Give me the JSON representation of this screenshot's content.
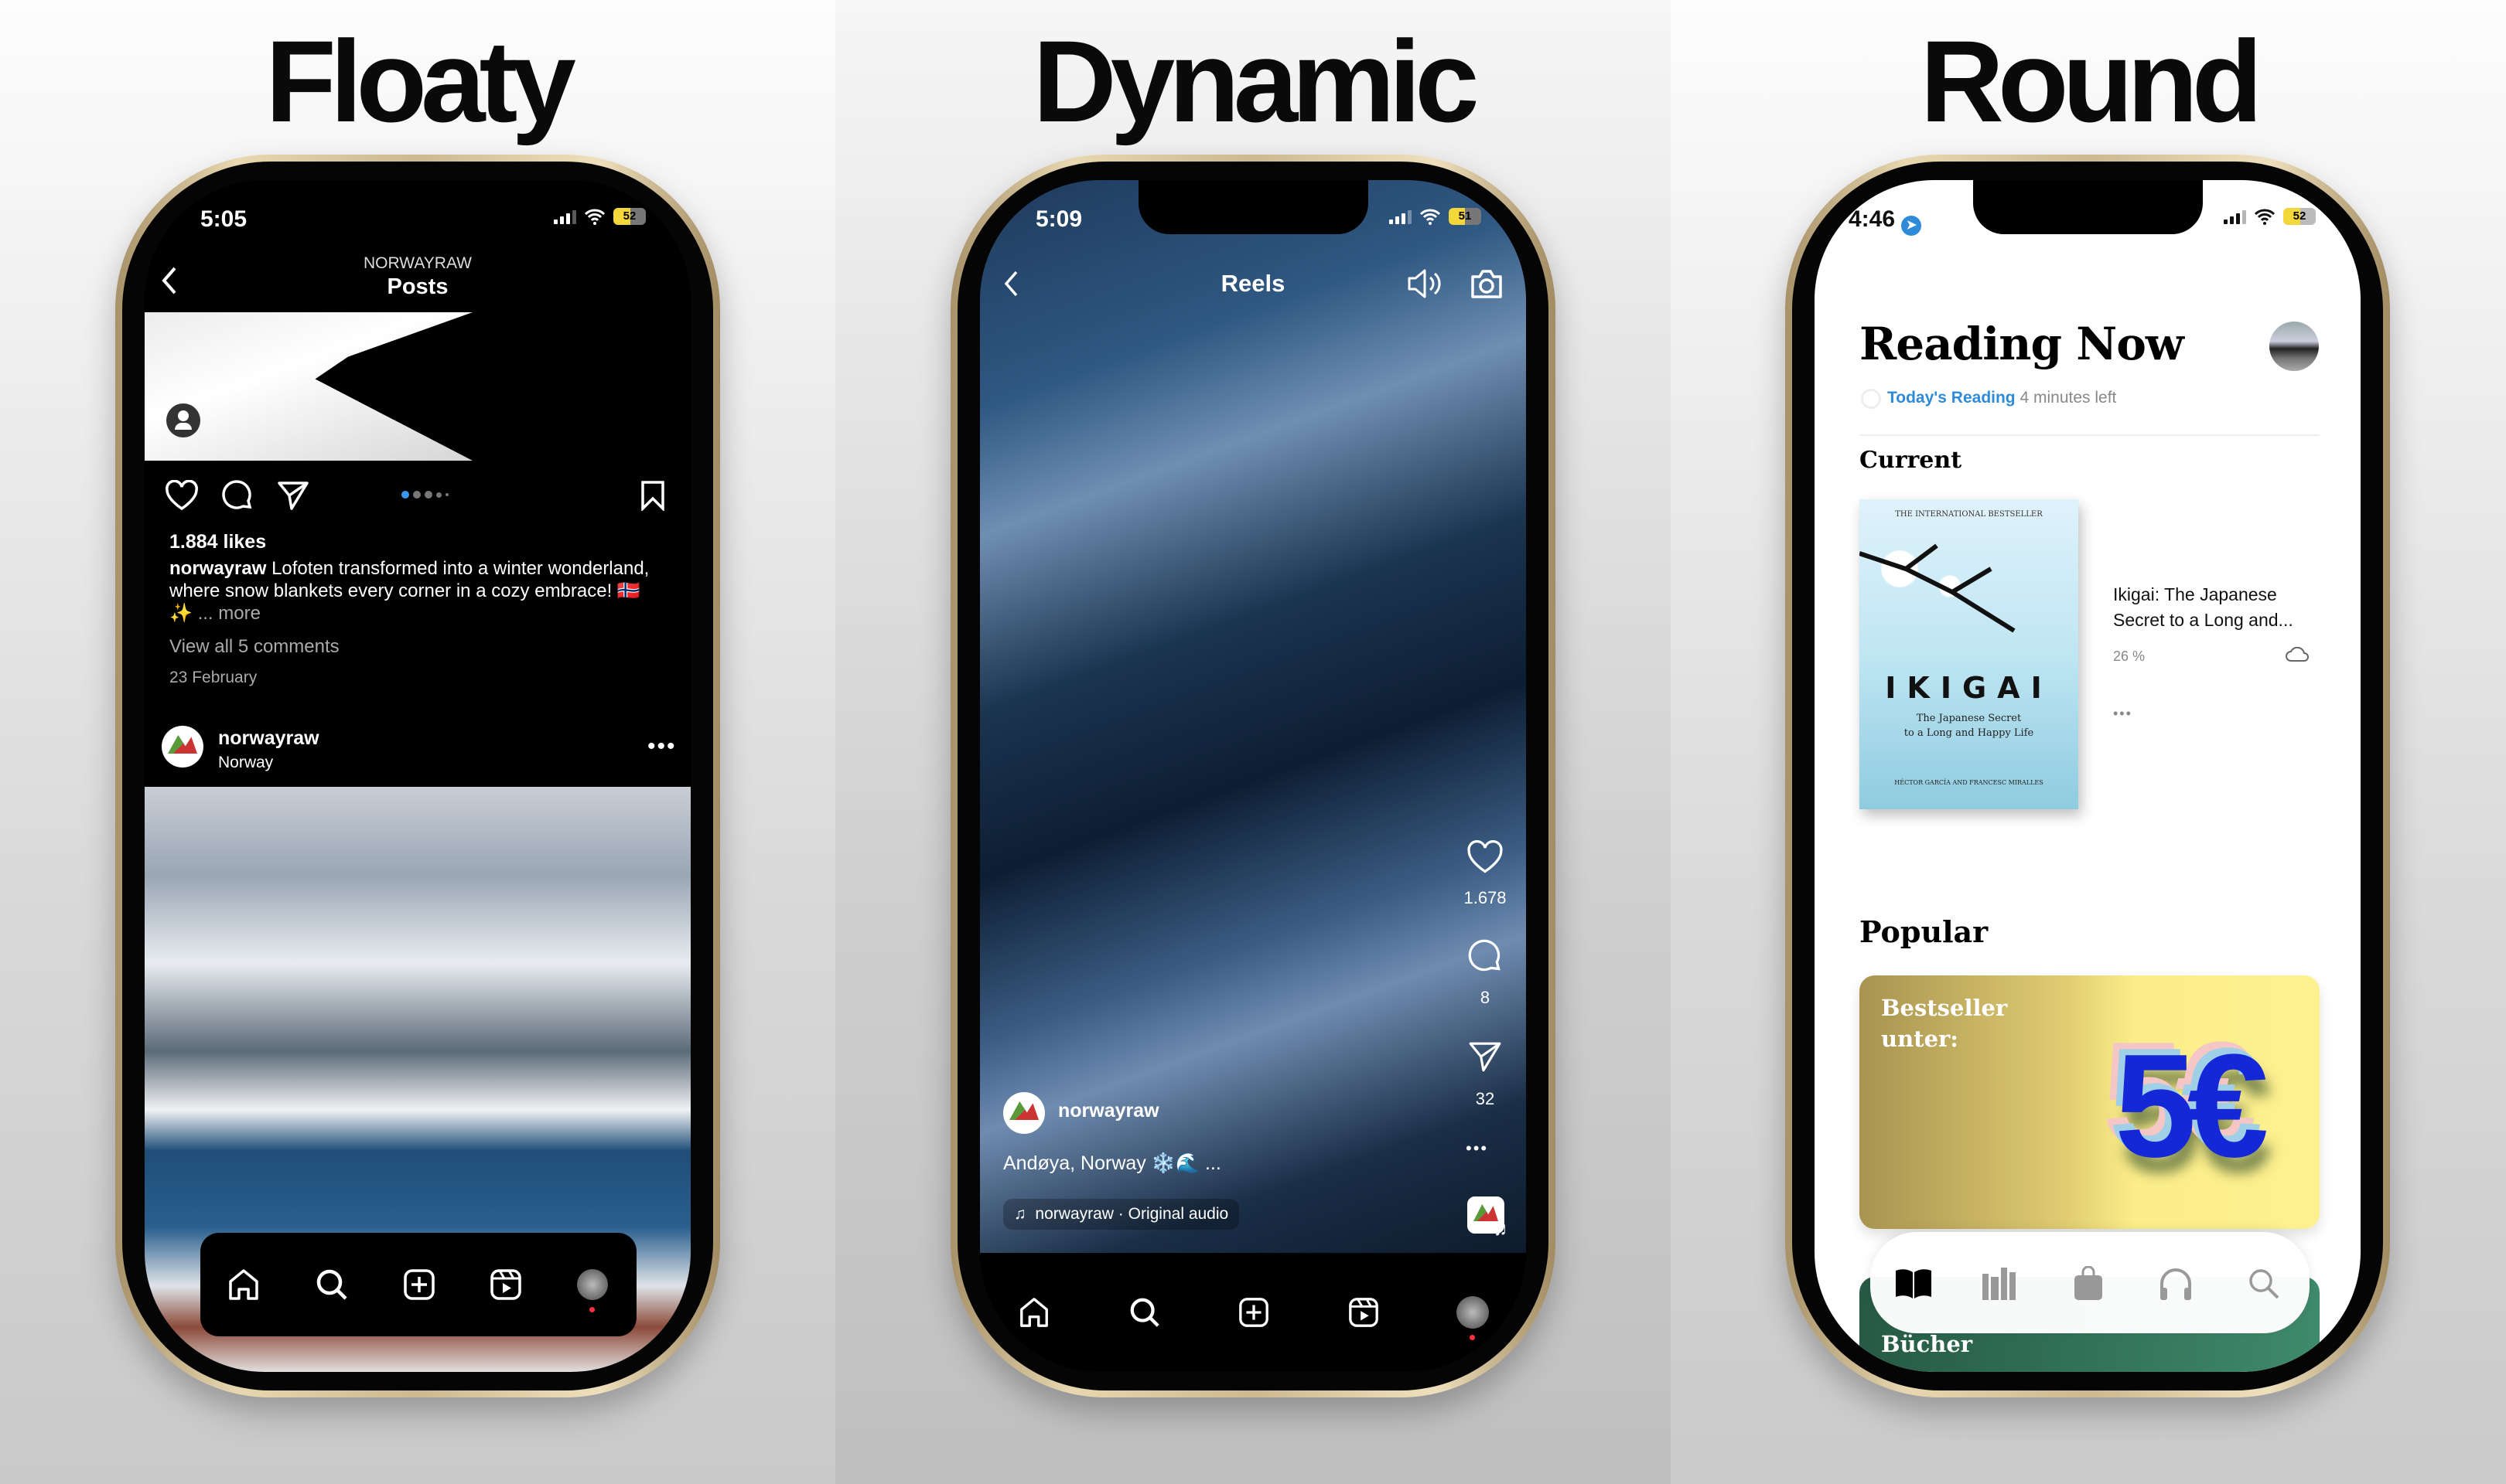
{
  "headings": [
    "Floaty",
    "Dynamic",
    "Round"
  ],
  "floaty": {
    "status": {
      "time": "5:05",
      "battery": "52"
    },
    "header": {
      "account": "NORWAYRAW",
      "title": "Posts"
    },
    "post": {
      "likes": "1.884 likes",
      "username": "norwayraw",
      "caption": "Lofoten transformed into a winter wonderland, where snow blankets every corner in a cozy embrace! 🇳🇴 ✨",
      "more": "... more",
      "comments": "View all 5 comments",
      "date": "23 February",
      "carousel_index": 1,
      "carousel_count": 5
    },
    "next_post": {
      "username": "norwayraw",
      "location": "Norway"
    },
    "tabbar": {
      "icons": [
        "home-icon",
        "search-icon",
        "create-icon",
        "reels-icon",
        "profile-avatar"
      ]
    }
  },
  "dynamic": {
    "status": {
      "time": "5:09",
      "battery": "51"
    },
    "header": {
      "title": "Reels"
    },
    "actions": {
      "likes": "1.678",
      "comments": "8",
      "shares": "32"
    },
    "reel": {
      "username": "norwayraw",
      "caption": "Andøya, Norway ❄️🌊 ...",
      "audio": "norwayraw · Original audio"
    }
  },
  "round": {
    "status": {
      "time": "4:46",
      "battery": "52"
    },
    "title": "Reading Now",
    "goal": {
      "label": "Today's Reading",
      "remaining": "4 minutes left"
    },
    "current_heading": "Current",
    "book": {
      "cover_top": "THE INTERNATIONAL BESTSELLER",
      "cover_title": "IKIGAI",
      "cover_subtitle1": "The Japanese Secret",
      "cover_subtitle2": "to a Long and Happy Life",
      "cover_authors": "HÉCTOR GARCÍA AND FRANCESC MIRALLES",
      "title_line1": "Ikigai: The Japanese",
      "title_line2": "Secret to a Long and...",
      "progress": "26 %"
    },
    "popular_heading": "Popular",
    "banner": {
      "line1": "Bestseller",
      "line2": "unter:",
      "price": "5€"
    },
    "next_card": "Bücher",
    "accent": "#2f8ad8"
  }
}
